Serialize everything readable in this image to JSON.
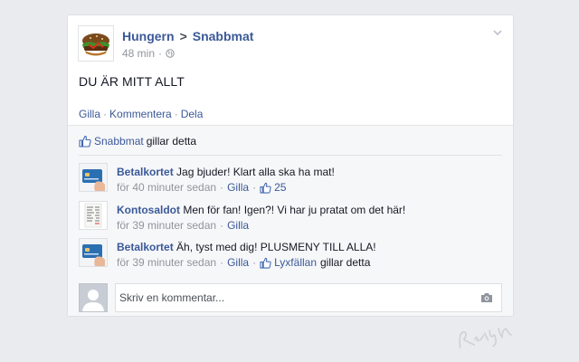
{
  "post": {
    "author": "Hungern",
    "target": "Snabbmat",
    "arrow": ">",
    "time": "48 min",
    "meta_dot": "·",
    "text": "DU ÄR MITT ALLT",
    "actions": {
      "like": "Gilla",
      "comment": "Kommentera",
      "share": "Dela",
      "dot": "·"
    }
  },
  "likes": {
    "name": "Snabbmat",
    "text": "gillar detta"
  },
  "comments": [
    {
      "author": "Betalkortet",
      "text": "Jag bjuder! Klart alla ska ha mat!",
      "time": "för 40 minuter sedan",
      "like_label": "Gilla",
      "like_count": "25"
    },
    {
      "author": "Kontosaldot",
      "text": "Men för fan! Igen?! Vi har ju pratat om det här!",
      "time": "för 39 minuter sedan",
      "like_label": "Gilla"
    },
    {
      "author": "Betalkortet",
      "text": "Äh, tyst med dig! PLUSMENY TILL ALLA!",
      "time": "för 39 minuter sedan",
      "like_label": "Gilla",
      "liked_by": "Lyxfällan",
      "liked_text": "gillar detta"
    }
  ],
  "composer": {
    "placeholder": "Skriv en kommentar..."
  },
  "icons": {
    "like": "thumbs-up-icon",
    "globe": "globe-icon",
    "camera": "camera-icon",
    "menu": "chevron-down-icon"
  },
  "colors": {
    "link": "#3b5998",
    "meta": "#90949c",
    "background": "#e9ebee"
  }
}
